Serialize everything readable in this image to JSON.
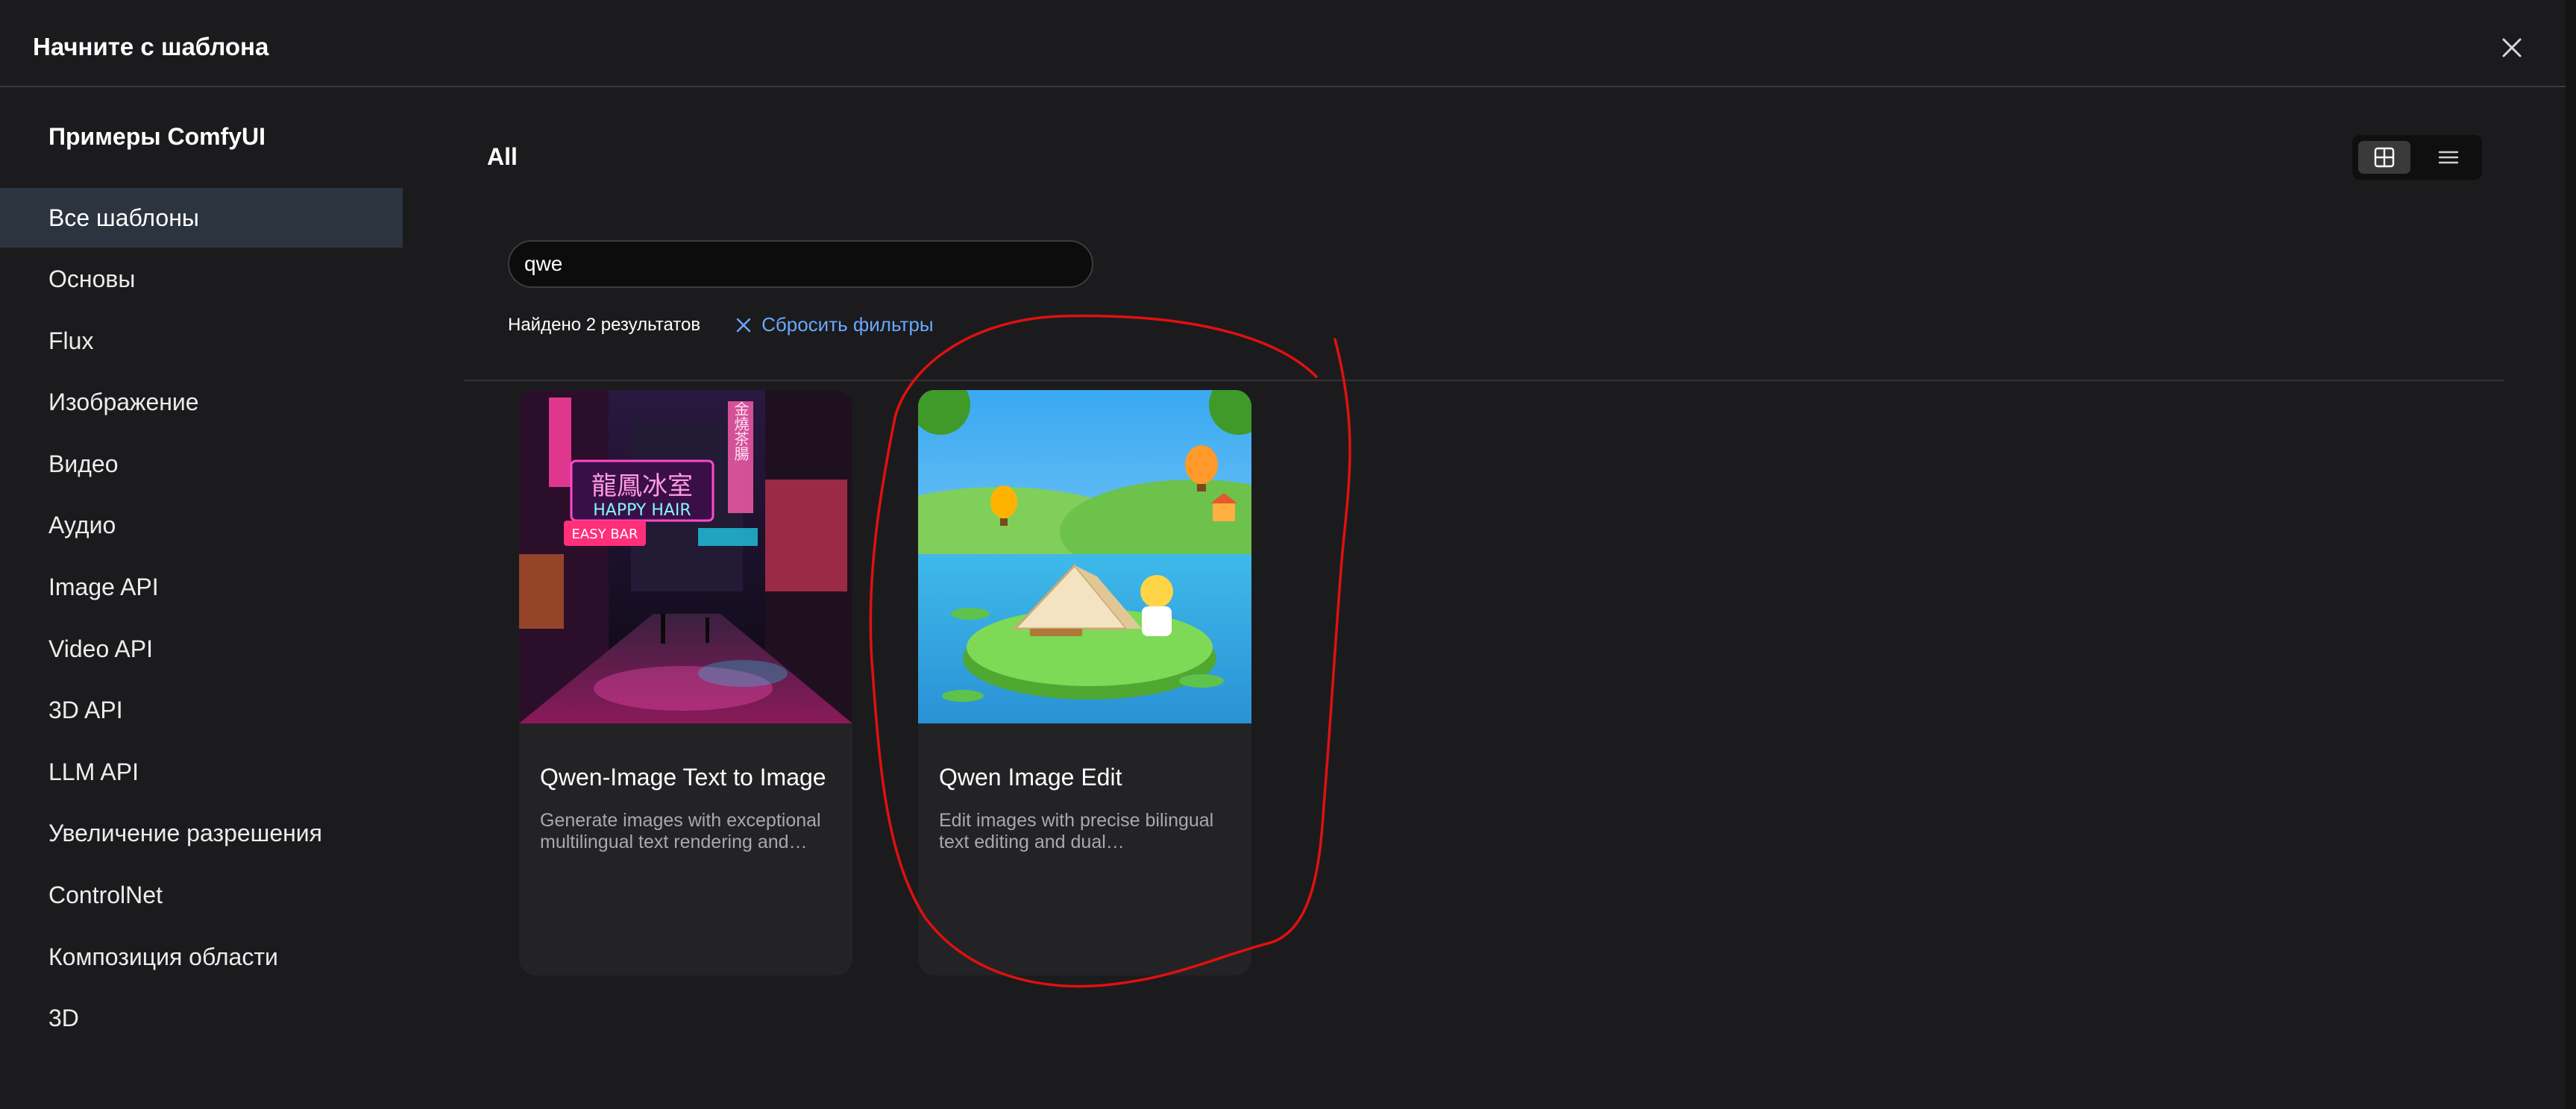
{
  "dialog": {
    "title": "Начните с шаблона",
    "close_icon": "close-icon"
  },
  "sidebar": {
    "title": "Примеры ComfyUI",
    "items": [
      {
        "label": "Все шаблоны",
        "active": true
      },
      {
        "label": "Основы"
      },
      {
        "label": "Flux"
      },
      {
        "label": "Изображение"
      },
      {
        "label": "Видео"
      },
      {
        "label": "Аудио"
      },
      {
        "label": "Image API"
      },
      {
        "label": "Video API"
      },
      {
        "label": "3D API"
      },
      {
        "label": "LLM API"
      },
      {
        "label": "Увеличение разрешения"
      },
      {
        "label": "ControlNet"
      },
      {
        "label": "Композиция области"
      },
      {
        "label": "3D"
      }
    ]
  },
  "main": {
    "title": "All",
    "view_toggle": {
      "grid_icon": "grid-icon",
      "list_icon": "list-icon",
      "selected": "grid"
    },
    "search": {
      "value": "qwe"
    },
    "results": {
      "count_text": "Найдено 2 результатов",
      "reset_label": "Сбросить фильтры"
    },
    "cards": [
      {
        "title": "Qwen-Image Text to Image",
        "description": "Generate images with exceptional multilingual text rendering and…",
        "thumb_signs": [
          "龍鳳冰室",
          "HAPPY HAIR",
          "EASY BAR",
          "金燒茶腸"
        ]
      },
      {
        "title": "Qwen Image Edit",
        "description": "Edit images with precise bilingual text editing and dual…"
      }
    ]
  },
  "colors": {
    "background": "#1b1b1d",
    "sidebar_active": "#2c3440",
    "accent_link": "#6aa8ff",
    "annotation_stroke": "#e01010"
  }
}
